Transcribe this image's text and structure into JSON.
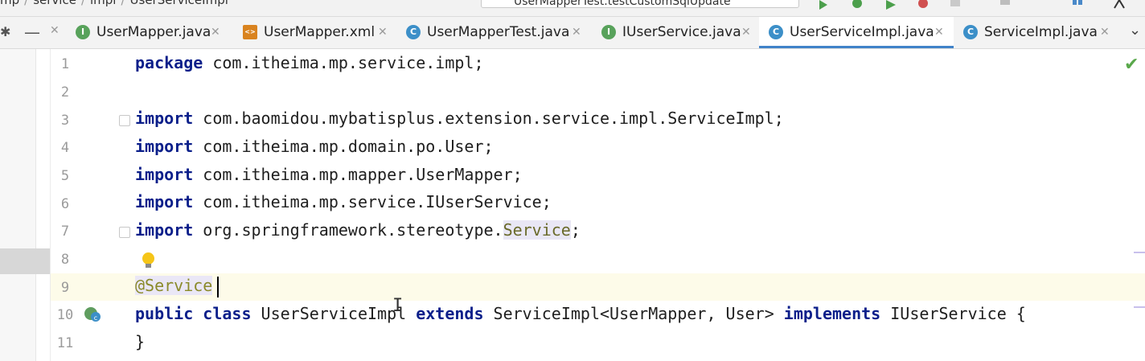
{
  "breadcrumb": {
    "items": [
      "mp",
      "service",
      "impl",
      "UserServiceImpl"
    ]
  },
  "run_config": {
    "label": "UserMapperTest.testCustomSqlUpdate"
  },
  "tabs": [
    {
      "label": "UserMapper.java",
      "icon": "interface-icon",
      "active": false
    },
    {
      "label": "UserMapper.xml",
      "icon": "xml-file-icon",
      "active": false
    },
    {
      "label": "UserMapperTest.java",
      "icon": "test-class-icon",
      "active": false
    },
    {
      "label": "IUserService.java",
      "icon": "interface-icon",
      "active": false
    },
    {
      "label": "UserServiceImpl.java",
      "icon": "class-icon",
      "active": true
    },
    {
      "label": "ServiceImpl.java",
      "icon": "class-icon",
      "active": false
    }
  ],
  "editor": {
    "line_numbers": [
      "1",
      "2",
      "3",
      "4",
      "5",
      "6",
      "7",
      "8",
      "9",
      "10",
      "11"
    ],
    "lines": {
      "l1": {
        "kw": "package",
        "rest": " com.itheima.mp.service.impl;"
      },
      "l3": {
        "kw": "import",
        "rest": " com.baomidou.mybatisplus.extension.service.impl.ServiceImpl;"
      },
      "l4": {
        "kw": "import",
        "rest": " com.itheima.mp.domain.po.User;"
      },
      "l5": {
        "kw": "import",
        "rest": " com.itheima.mp.mapper.UserMapper;"
      },
      "l6": {
        "kw": "import",
        "rest": " com.itheima.mp.service.IUserService;"
      },
      "l7": {
        "kw": "import",
        "rest_a": " org.springframework.stereotype.",
        "ref": "Service",
        "rest_b": ";"
      },
      "l9": {
        "at": "@",
        "anno": "Service"
      },
      "l10": {
        "kw1": "public",
        "kw2": "class",
        "name": " UserServiceImpl ",
        "kw3": "extends",
        "mid": " ServiceImpl<UserMapper, User> ",
        "kw4": "implements",
        "tail": " IUserService {"
      },
      "l11": {
        "text": "}"
      }
    }
  },
  "colors": {
    "keyword": "#0b1f8a",
    "active_tab_underline": "#4083c9",
    "current_line": "#fdfbe9"
  }
}
